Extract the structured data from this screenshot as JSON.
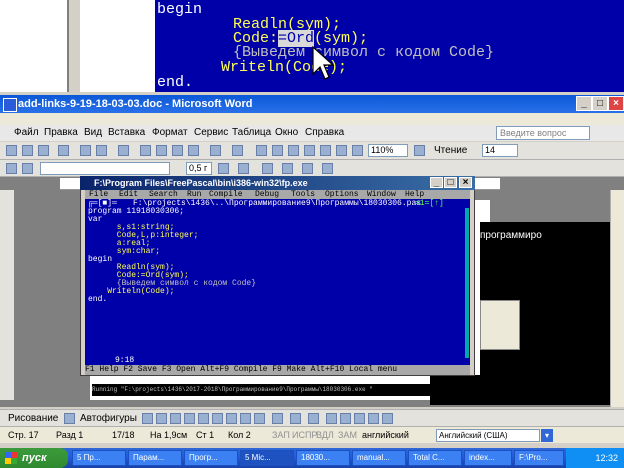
{
  "zoom": {
    "begin": "begin",
    "readln": "Readln(sym);",
    "code_pre": "Code:",
    "code_hl": "=Ord",
    "code_post": "(sym);",
    "comment": "{Выведем символ с кодом Code}",
    "writeln": "Writeln(Code);",
    "end": "end."
  },
  "word": {
    "title": "add-links-9-19-18-03-03.doc - Microsoft Word",
    "menu": [
      "Файл",
      "Правка",
      "Вид",
      "Вставка",
      "Формат",
      "Сервис",
      "Таблица",
      "Окно",
      "Справка"
    ],
    "ask_placeholder": "Введите вопрос",
    "zoom": "110%",
    "reading": "Чтение",
    "font_size": "14",
    "size_field": "0,5 г",
    "right_text": "программиро"
  },
  "fp": {
    "title": "F:\\Program Files\\FreePascal\\bin\\i386-win32\\fp.exe",
    "menu": [
      "File",
      "Edit",
      "Search",
      "Run",
      "Compile",
      "Debug",
      "Tools",
      "Options",
      "Window",
      "Help"
    ],
    "file_path": "F:\\projects\\1436\\..\\Программирование9\\Программы\\18030306.pas",
    "window_no": "=1=[↑]",
    "code": [
      "program 11918030306;",
      "var",
      "      s,s1:string;",
      "      Code,L,p:integer;",
      "      a:real;",
      "      sym:char;",
      "begin",
      "      Readln(sym);",
      "      Code:=Ord(sym);",
      "      {Выведем символ с кодом Code}",
      "    Writeln(Code);",
      "end."
    ],
    "position": "9:18",
    "status": "F1 Help  F2 Save  F3 Open  Alt+F9 Compile  F9 Make  Alt+F10 Local menu",
    "running": "Running \"F:\\projects\\1436\\2017-2018\\Программирование9\\Программы\\18030306.exe \""
  },
  "drawing": {
    "draw": "Рисование",
    "autoshapes": "Автофигуры"
  },
  "status": {
    "page": "Стр. 17",
    "section": "Разд 1",
    "pages": "17/18",
    "at": "На 1,9см",
    "line": "Ст 1",
    "col": "Кол 2",
    "rec": "ЗАП",
    "trk": "ИСПР",
    "ext": "ВДЛ",
    "ovr": "ЗАМ",
    "lang": "английский",
    "lang_select": "Английский (США)"
  },
  "taskbar": {
    "start": "пуск",
    "tasks": [
      "5 Пр...",
      "Парам...",
      "Прогр...",
      "5 Mic...",
      "18030...",
      "manual...",
      "Total C...",
      "index...",
      "F:\\Pro..."
    ],
    "clock": "12:32"
  }
}
